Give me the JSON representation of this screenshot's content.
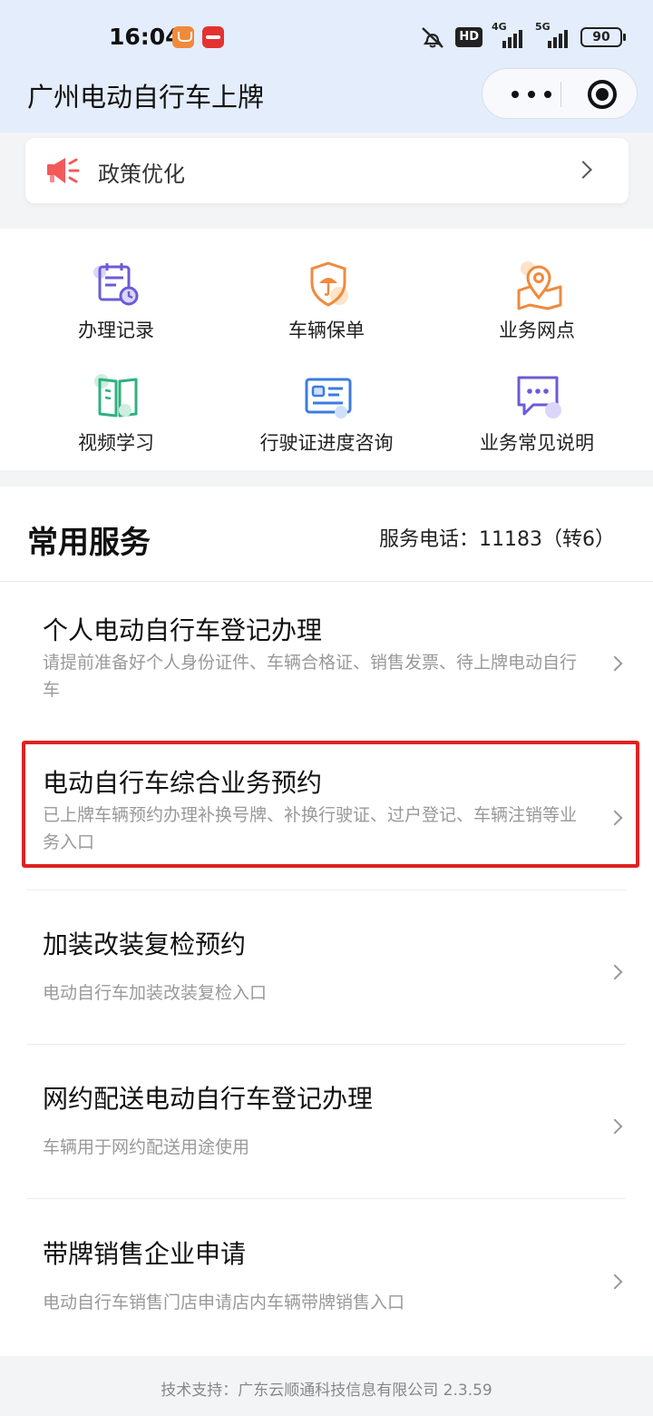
{
  "status_bar": {
    "time": "16:04",
    "hd": "HD",
    "net1": "4G",
    "net2": "5G",
    "battery": "90"
  },
  "app": {
    "title": "广州电动自行车上牌"
  },
  "policy": {
    "label": "政策优化"
  },
  "quick_actions": [
    {
      "label": "办理记录",
      "icon": "calendar-clock-icon"
    },
    {
      "label": "车辆保单",
      "icon": "shield-umbrella-icon"
    },
    {
      "label": "业务网点",
      "icon": "map-pin-icon"
    },
    {
      "label": "视频学习",
      "icon": "book-icon"
    },
    {
      "label": "行驶证进度咨询",
      "icon": "id-card-icon"
    },
    {
      "label": "业务常见说明",
      "icon": "chat-bubble-icon"
    }
  ],
  "services": {
    "title": "常用服务",
    "phone": "服务电话：11183（转6）",
    "items": [
      {
        "title": "个人电动自行车登记办理",
        "desc": "请提前准备好个人身份证件、车辆合格证、销售发票、待上牌电动自行车"
      },
      {
        "title": "电动自行车综合业务预约",
        "desc": "已上牌车辆预约办理补换号牌、补换行驶证、过户登记、车辆注销等业务入口"
      },
      {
        "title": "加装改装复检预约",
        "desc": "电动自行车加装改装复检入口"
      },
      {
        "title": "网约配送电动自行车登记办理",
        "desc": "车辆用于网约配送用途使用"
      },
      {
        "title": "带牌销售企业申请",
        "desc": "电动自行车销售门店申请店内车辆带牌销售入口"
      }
    ]
  },
  "footer": {
    "text": "技术支持：广东云顺通科技信息有限公司 2.3.59"
  },
  "colors": {
    "header_bg": "#e4edfb",
    "highlight": "#e02121",
    "icon_purple": "#6b5bd6",
    "icon_orange": "#f08a3c",
    "icon_green": "#2fb07f",
    "icon_blue": "#3b7be0"
  }
}
